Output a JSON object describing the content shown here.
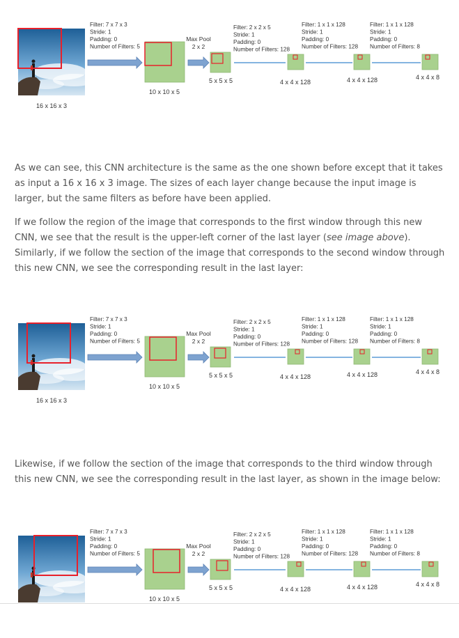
{
  "figures": [
    {
      "window": "first",
      "input_size": "16 x 16 x 3",
      "conv1": {
        "filter": "Filter: 7 x 7 x 3",
        "stride": "Stride: 1",
        "padding": "Padding: 0",
        "num_filters": "Number of Filters: 5"
      },
      "layer1_size": "10 x 10 x 5",
      "pool": {
        "title": "Max Pool",
        "size": "2 x 2"
      },
      "layer2_size": "5 x 5 x 5",
      "conv2": {
        "filter": "Filter: 2 x 2 x 5",
        "stride": "Stride: 1",
        "padding": "Padding: 0",
        "num_filters": "Number of Filters: 128"
      },
      "layer3_size": "4 x 4 x 128",
      "conv3": {
        "filter": "Filter: 1 x 1 x 128",
        "stride": "Stride: 1",
        "padding": "Padding: 0",
        "num_filters": "Number of Filters: 128"
      },
      "layer4_size": "4 x 4 x 128",
      "conv4": {
        "filter": "Filter: 1 x 1 x 128",
        "stride": "Stride: 1",
        "padding": "Padding: 0",
        "num_filters": "Number of Filters: 8"
      },
      "layer5_size": "4 x 4 x 8"
    },
    {
      "window": "second",
      "input_size": "16 x 16 x 3",
      "conv1": {
        "filter": "Filter: 7 x 7 x 3",
        "stride": "Stride: 1",
        "padding": "Padding: 0",
        "num_filters": "Number of Filters: 5"
      },
      "layer1_size": "10 x 10 x 5",
      "pool": {
        "title": "Max Pool",
        "size": "2 x 2"
      },
      "layer2_size": "5 x 5 x 5",
      "conv2": {
        "filter": "Filter: 2 x 2 x 5",
        "stride": "Stride: 1",
        "padding": "Padding: 0",
        "num_filters": "Number of Filters: 128"
      },
      "layer3_size": "4 x 4 x 128",
      "conv3": {
        "filter": "Filter: 1 x 1 x 128",
        "stride": "Stride: 1",
        "padding": "Padding: 0",
        "num_filters": "Number of Filters: 128"
      },
      "layer4_size": "4 x 4 x 128",
      "conv4": {
        "filter": "Filter: 1 x 1 x 128",
        "stride": "Stride: 1",
        "padding": "Padding: 0",
        "num_filters": "Number of Filters: 8"
      },
      "layer5_size": "4 x 4 x 8"
    },
    {
      "window": "third",
      "input_size": "",
      "conv1": {
        "filter": "Filter: 7 x 7 x 3",
        "stride": "Stride: 1",
        "padding": "Padding: 0",
        "num_filters": "Number of Filters: 5"
      },
      "layer1_size": "10 x 10 x 5",
      "pool": {
        "title": "Max Pool",
        "size": "2 x 2"
      },
      "layer2_size": "5 x 5 x 5",
      "conv2": {
        "filter": "Filter: 2 x 2 x 5",
        "stride": "Stride: 1",
        "padding": "Padding: 0",
        "num_filters": "Number of Filters: 128"
      },
      "layer3_size": "4 x 4 x 128",
      "conv3": {
        "filter": "Filter: 1 x 1 x 128",
        "stride": "Stride: 1",
        "padding": "Padding: 0",
        "num_filters": "Number of Filters: 128"
      },
      "layer4_size": "4 x 4 x 128",
      "conv4": {
        "filter": "Filter: 1 x 1 x 128",
        "stride": "Stride: 1",
        "padding": "Padding: 0",
        "num_filters": "Number of Filters: 8"
      },
      "layer5_size": "4 x 4 x 8"
    }
  ],
  "text": {
    "para1": "As we can see, this CNN architecture is the same as the one shown before except that it takes as input a 16 x 16 x 3 image. The sizes of each layer change because the input image is larger, but the same filters as before have been applied.",
    "para2_before": "If we follow the region of the image that corresponds to the first window through this new CNN, we see that the result is the upper-left corner of the last layer (",
    "para2_em": "see image above",
    "para2_after": "). Similarly, if we follow the section of the image that corresponds to the second window through this new CNN, we see the corresponding result in the last layer:",
    "para3": "Likewise, if we follow the section of the image that corresponds to the third window through this new CNN, we see the corresponding result in the last layer, as shown in the image below:"
  },
  "colors": {
    "layer_fill": "#a9d18e",
    "layer_stroke": "#8fb874",
    "window_stroke": "#e8202a",
    "arrow_fill": "#7ea3d0",
    "arrow_stroke": "#5b82b5",
    "connector": "#5b9bd5"
  }
}
